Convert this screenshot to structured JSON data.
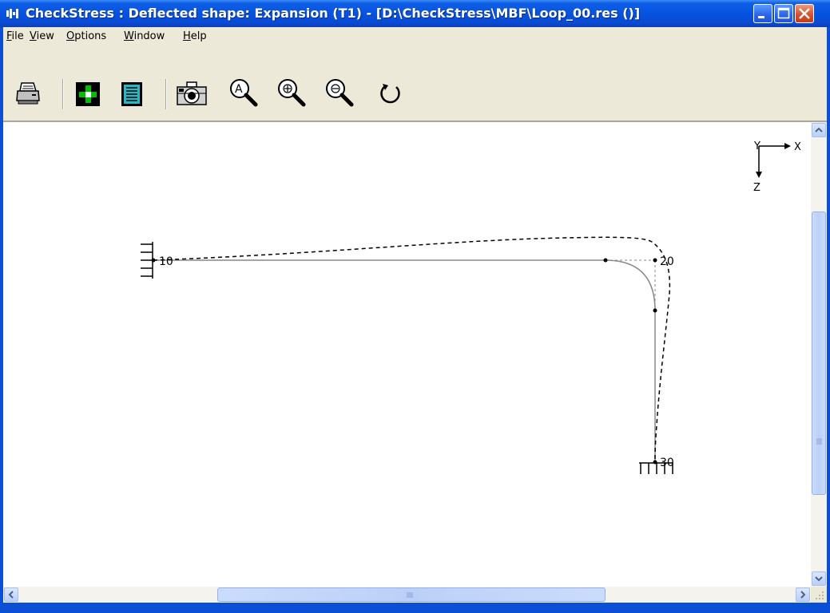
{
  "window": {
    "title": "CheckStress : Deflected shape: Expansion (T1) -  [D:\\CheckStress\\MBF\\Loop_00.res ()]"
  },
  "menu": {
    "items": [
      {
        "accel": "F",
        "rest": "ile"
      },
      {
        "accel": "V",
        "rest": "iew"
      },
      {
        "accel": "O",
        "rest": "ptions"
      },
      {
        "accel": "W",
        "rest": "indow"
      },
      {
        "accel": "H",
        "rest": "elp"
      }
    ]
  },
  "toolbar": {
    "tools": [
      "print-icon",
      "node-view-icon",
      "report-icon",
      "camera-icon",
      "zoom-all-icon",
      "zoom-in-icon",
      "zoom-out-icon",
      "redraw-icon"
    ]
  },
  "drawing": {
    "axes": {
      "x": "X",
      "y": "Y",
      "z": "Z"
    },
    "nodes": [
      {
        "id": "10"
      },
      {
        "id": "20"
      },
      {
        "id": "30"
      }
    ],
    "colors": {
      "original": "#888888",
      "deflected": "#000000"
    }
  }
}
